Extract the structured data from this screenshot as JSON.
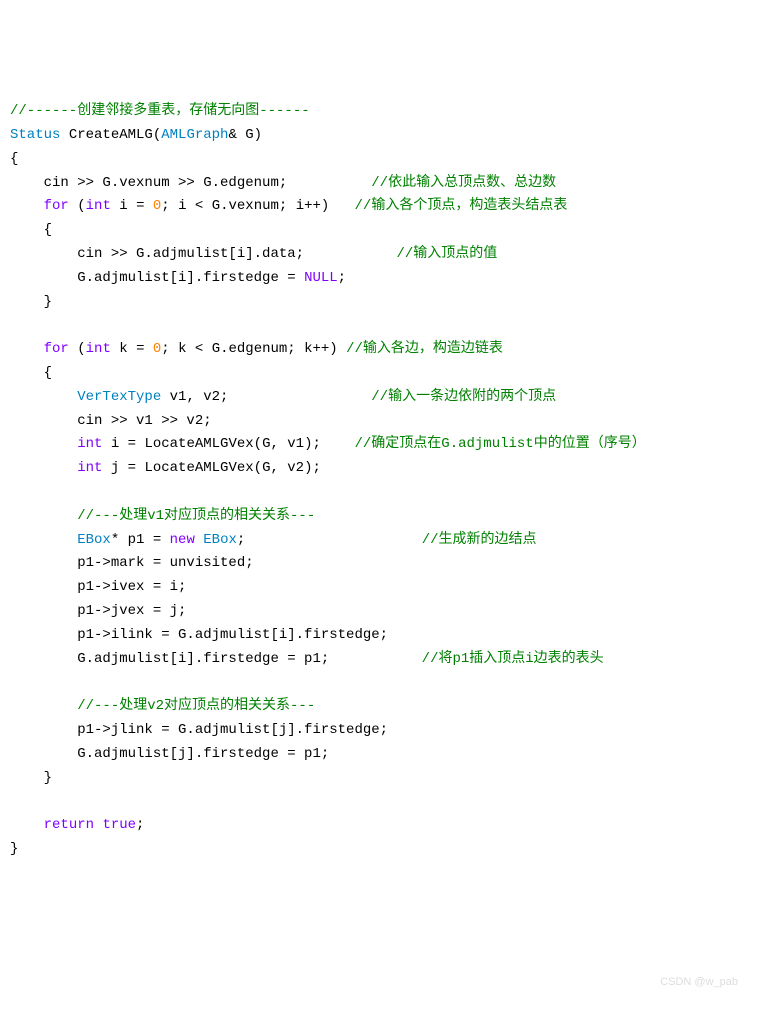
{
  "c1": "//------创建邻接多重表，存储无向图------",
  "l2a": "Status",
  "l2b": " CreateAMLG(",
  "l2c": "AMLGraph",
  "l2d": "& G)",
  "l3": "{",
  "l4a": "    cin >> G.vexnum >> G.edgenum;          ",
  "c4": "//依此输入总顶点数、总边数",
  "l5a": "    ",
  "l5b": "for",
  "l5c": " (",
  "l5d": "int",
  "l5e": " i = ",
  "l5f": "0",
  "l5g": "; i < G.vexnum; i++)   ",
  "c5": "//输入各个顶点，构造表头结点表",
  "l6": "    {",
  "l7a": "        cin >> G.adjmulist[i].data;           ",
  "c7": "//输入顶点的值",
  "l8a": "        G.adjmulist[i].firstedge = ",
  "l8b": "NULL",
  "l8c": ";",
  "l9": "    }",
  "blank1": "",
  "l10a": "    ",
  "l10b": "for",
  "l10c": " (",
  "l10d": "int",
  "l10e": " k = ",
  "l10f": "0",
  "l10g": "; k < G.edgenum; k++) ",
  "c10": "//输入各边，构造边链表",
  "l11": "    {",
  "l12a": "        ",
  "l12b": "VerTexType",
  "l12c": " v1, v2;                 ",
  "c12": "//输入一条边依附的两个顶点",
  "l13": "        cin >> v1 >> v2;",
  "l14a": "        ",
  "l14b": "int",
  "l14c": " i = LocateAMLGVex(G, v1);    ",
  "c14": "//确定顶点在G.adjmulist中的位置（序号）",
  "l15a": "        ",
  "l15b": "int",
  "l15c": " j = LocateAMLGVex(G, v2);",
  "blank2": "",
  "l16a": "        ",
  "c16": "//---处理v1对应顶点的相关关系---",
  "l17a": "        ",
  "l17b": "EBox",
  "l17c": "* p1 = ",
  "l17d": "new",
  "l17e": " ",
  "l17f": "EBox",
  "l17g": ";                     ",
  "c17": "//生成新的边结点",
  "l18": "        p1->mark = unvisited;",
  "l19": "        p1->ivex = i;",
  "l20": "        p1->jvex = j;",
  "l21": "        p1->ilink = G.adjmulist[i].firstedge;",
  "l22a": "        G.adjmulist[i].firstedge = p1;           ",
  "c22": "//将p1插入顶点i边表的表头",
  "blank3": "",
  "l23a": "        ",
  "c23": "//---处理v2对应顶点的相关关系---",
  "l24": "        p1->jlink = G.adjmulist[j].firstedge;",
  "l25": "        G.adjmulist[j].firstedge = p1;",
  "l26": "    }",
  "blank4": "",
  "l27a": "    ",
  "l27b": "return",
  "l27c": " ",
  "l27d": "true",
  "l27e": ";",
  "l28": "}",
  "watermark": "CSDN @w_pab"
}
